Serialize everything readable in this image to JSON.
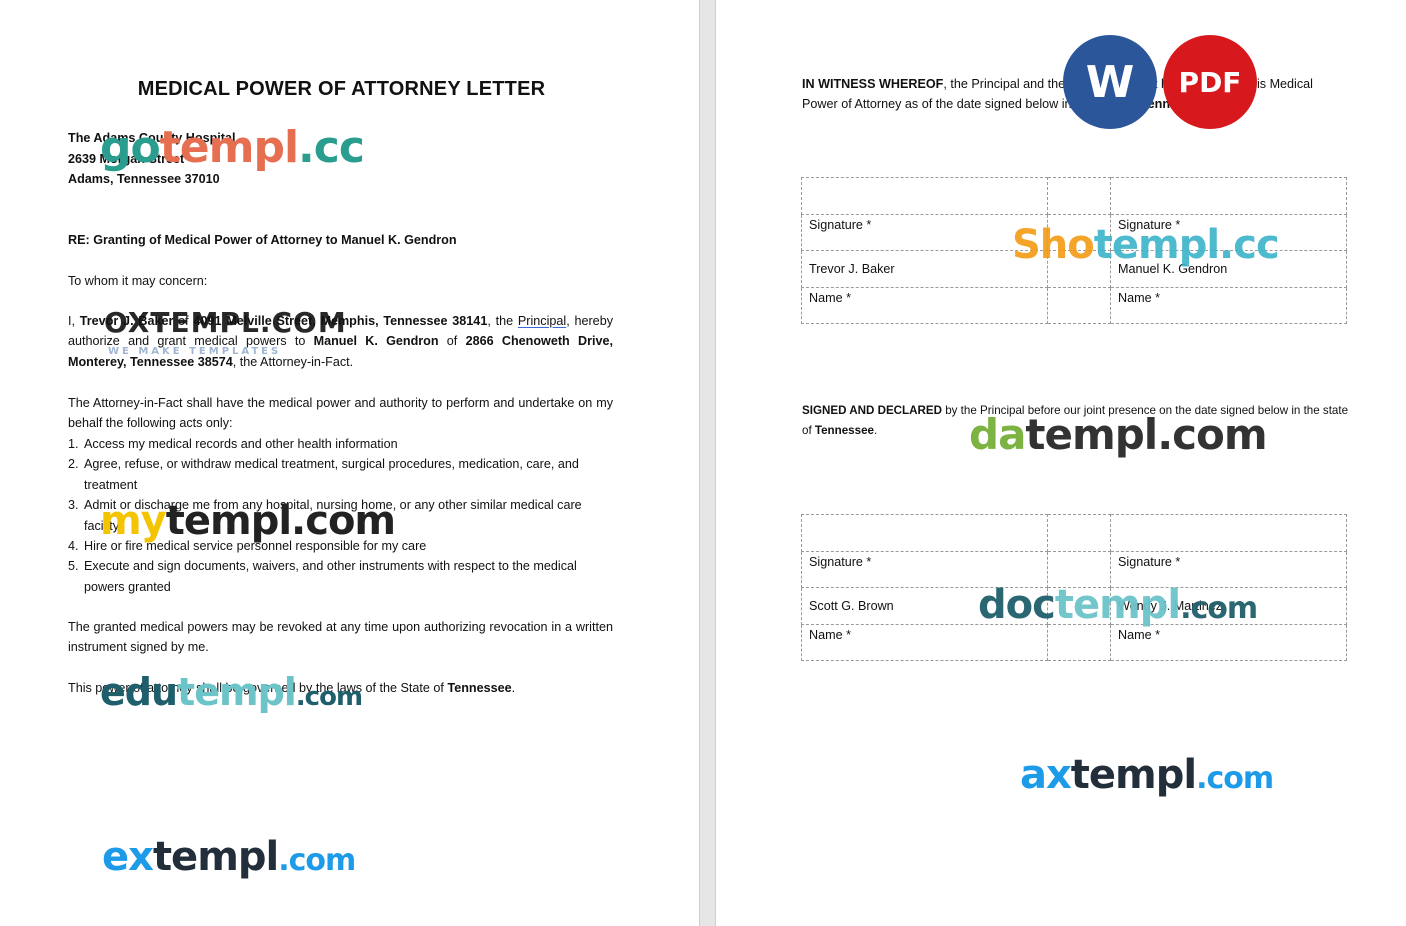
{
  "left_page": {
    "title": "MEDICAL POWER OF ATTORNEY LETTER",
    "address": [
      "The Adams County Hospital",
      "2639 Morgan Street",
      "Adams, Tennessee 37010"
    ],
    "re": "RE: Granting of Medical Power of Attorney to Manuel K. Gendron",
    "salutation": "To whom it may concern:",
    "p1": {
      "t1": "I, ",
      "principal_name": "Trevor J. Baker",
      "t2": " of ",
      "principal_address": "4091 Melville Street, Memphis, Tennessee 38141",
      "t3": ", the ",
      "principal_word": "Principal",
      "t4": ", hereby authorize and grant medical powers to ",
      "agent_name": "Manuel K. Gendron",
      "t5": " of ",
      "agent_address": "2866 Chenoweth Drive, Monterey, Tennessee 38574",
      "t6": ", the Attorney-in-Fact."
    },
    "p2": "The Attorney-in-Fact shall have the medical power and authority to perform and undertake on my behalf the following acts only:",
    "acts": [
      {
        "num": "1.",
        "text": "Access my medical records and other health information"
      },
      {
        "num": "2.",
        "text": "Agree, refuse, or withdraw medical treatment, surgical procedures, medication, care, and treatment"
      },
      {
        "num": "3.",
        "text": "Admit or discharge me from any hospital, nursing home, or any other similar medical care facility"
      },
      {
        "num": "4.",
        "text": "Hire or fire medical service personnel responsible for my care"
      },
      {
        "num": "5.",
        "text": "Execute and sign documents, waivers, and other instruments with respect to the medical powers granted"
      }
    ],
    "p3": "The granted medical powers may be revoked at any time upon authorizing revocation in a written instrument signed by me.",
    "p4": {
      "t1": "This power of attorney shall be governed by the laws of the State of ",
      "state": "Tennessee",
      "t2": "."
    }
  },
  "right_page": {
    "witness": {
      "lead": "IN WITNESS WHEREOF",
      "t1": ", the Principal and the Attorney-in-Fact have executed this Medical Power of Attorney as of the date signed below in the state of ",
      "state": "Tennessee",
      "t2": "."
    },
    "table1": {
      "signature_label": "Signature *",
      "name_label": "Name *",
      "left_name": "Trevor J. Baker",
      "right_name": "Manuel K. Gendron"
    },
    "declared": {
      "lead": "SIGNED AND DECLARED",
      "t1": " by the Principal before our joint presence on the date signed below in the state of ",
      "state": "Tennessee",
      "t2": "."
    },
    "table2": {
      "signature_label": "Signature *",
      "name_label": "Name *",
      "left_name": "Scott G. Brown",
      "right_name": "Wendy J. Martinez"
    }
  },
  "badges": {
    "word": "W",
    "pdf": "PDF"
  },
  "watermarks": {
    "gotempl": {
      "a": "go",
      "b": "templ",
      "c": ".cc"
    },
    "oxtempl": {
      "main": "OXTEMPL.COM",
      "sub": "WE MAKE TEMPLATES"
    },
    "mytempl": {
      "a": "my",
      "b": "templ.com"
    },
    "edutempl": {
      "a": "edu",
      "b": "templ",
      "c": ".com"
    },
    "extempl": {
      "a": "ex",
      "b": "templ",
      "c": ".com"
    },
    "shotempl": {
      "a": "Sho",
      "b": "templ.cc"
    },
    "datempl": {
      "a": "da",
      "b": "templ.com"
    },
    "doctempl": {
      "a": "doc",
      "b": "templ",
      "c": ".com"
    },
    "axtempl": {
      "a": "ax",
      "b": "templ",
      "c": ".com"
    }
  },
  "colors": {
    "word_blue": "#2b579a",
    "pdf_red": "#d7191d",
    "page_gutter": "#e6e6e6"
  }
}
